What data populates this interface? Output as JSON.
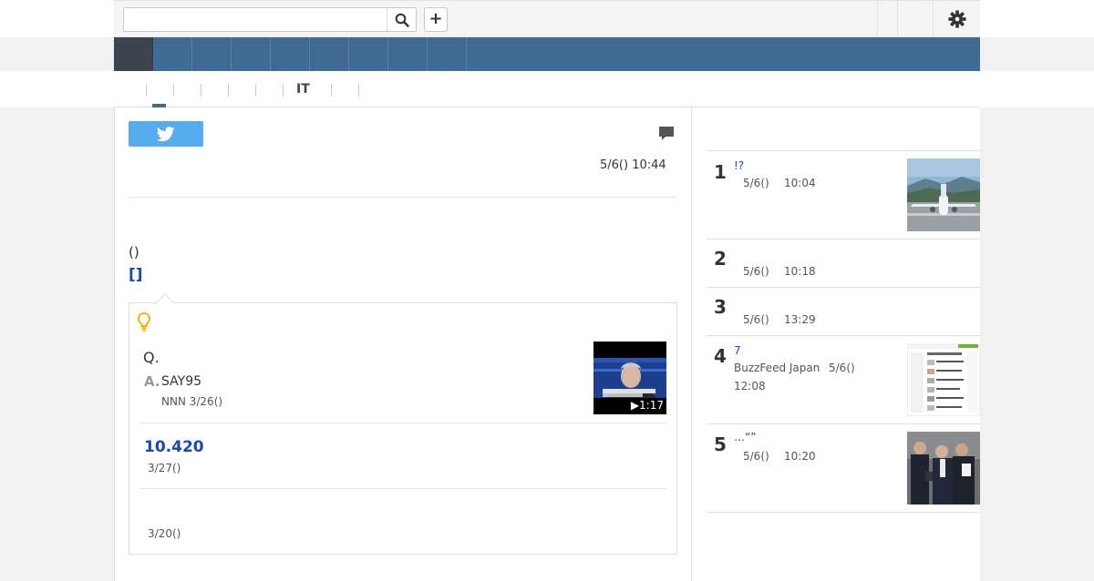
{
  "toolbar": {
    "search_placeholder": "",
    "add_label": "+",
    "search_icon": "search-icon",
    "settings_icon": "gear-icon"
  },
  "colors": {
    "nav_bg": "#3f6a93",
    "nav_active": "#3c4450",
    "link": "#1a47b8",
    "twitter": "#55acee"
  },
  "subnav": {
    "tab_label": "IT"
  },
  "article": {
    "date": "5/6() 10:44",
    "paren_text": "()",
    "bracket_link": "[]",
    "qa": {
      "question": "Q.",
      "answer_mark": "A.",
      "answer": "SAY95",
      "source": "NNN 3/26()",
      "video_duration": "1:17",
      "related_number": "10.420",
      "related_date": "3/27()",
      "related2_date": "3/20()"
    }
  },
  "ranking": [
    {
      "rank": "1",
      "title": "!?",
      "source": "",
      "date": "5/6()",
      "time": "10:04"
    },
    {
      "rank": "2",
      "title": "",
      "source": "",
      "date": "5/6()",
      "time": "10:18"
    },
    {
      "rank": "3",
      "title": "",
      "source": "",
      "date": "5/6()",
      "time": "13:29"
    },
    {
      "rank": "4",
      "title": "7",
      "source": "BuzzFeed Japan",
      "date": "5/6()",
      "time": "12:08"
    },
    {
      "rank": "5",
      "title": "…“”",
      "source": "",
      "date": "5/6()",
      "time": "10:20"
    }
  ]
}
